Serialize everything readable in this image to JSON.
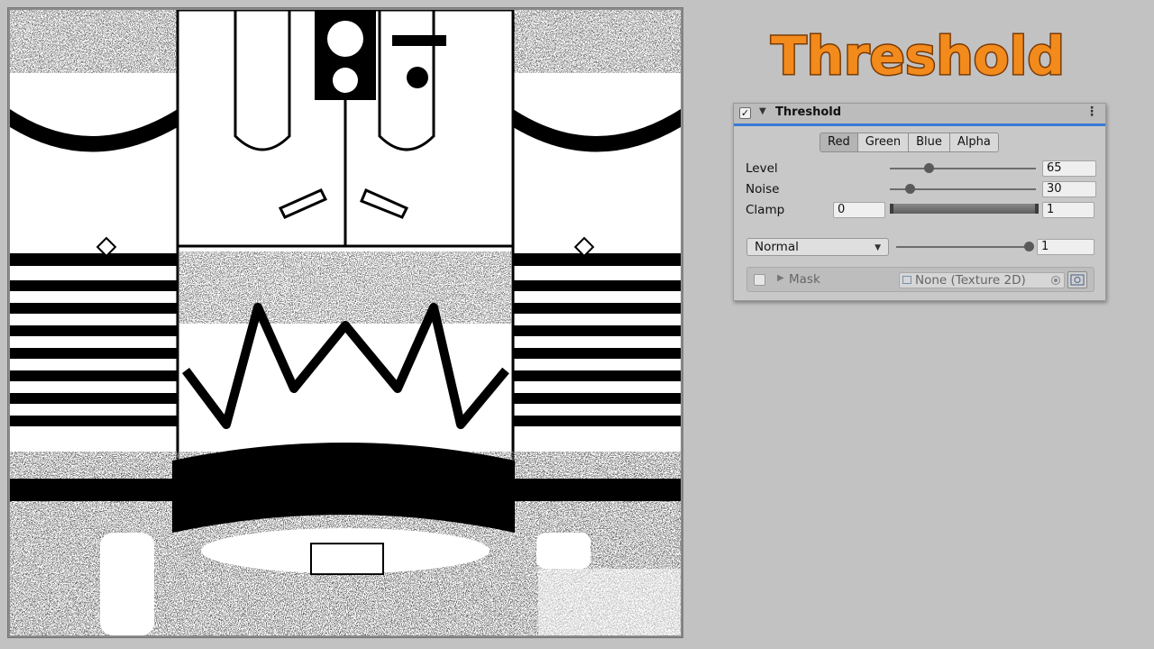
{
  "heading": {
    "title": "Threshold",
    "fill": "#f28a1c",
    "outline": "#7a3b06"
  },
  "panel": {
    "enabled_mark": "✓",
    "fold_icon": "▼",
    "title": "Threshold",
    "menu_icon": "⋮",
    "accent": "#3a79d6",
    "channels": [
      {
        "label": "Red",
        "selected": true
      },
      {
        "label": "Green",
        "selected": false
      },
      {
        "label": "Blue",
        "selected": false
      },
      {
        "label": "Alpha",
        "selected": false
      }
    ],
    "level": {
      "label": "Level",
      "value": "65",
      "fraction": 0.27
    },
    "noise": {
      "label": "Noise",
      "value": "30",
      "fraction": 0.14
    },
    "clamp": {
      "label": "Clamp",
      "min": "0",
      "max": "1"
    },
    "blend": {
      "mode": "Normal",
      "arrow": "▼",
      "opacity": "1",
      "fraction": 1.0
    },
    "mask": {
      "fold_icon": "▶",
      "label": "Mask",
      "texture": "None (Texture 2D)"
    }
  }
}
